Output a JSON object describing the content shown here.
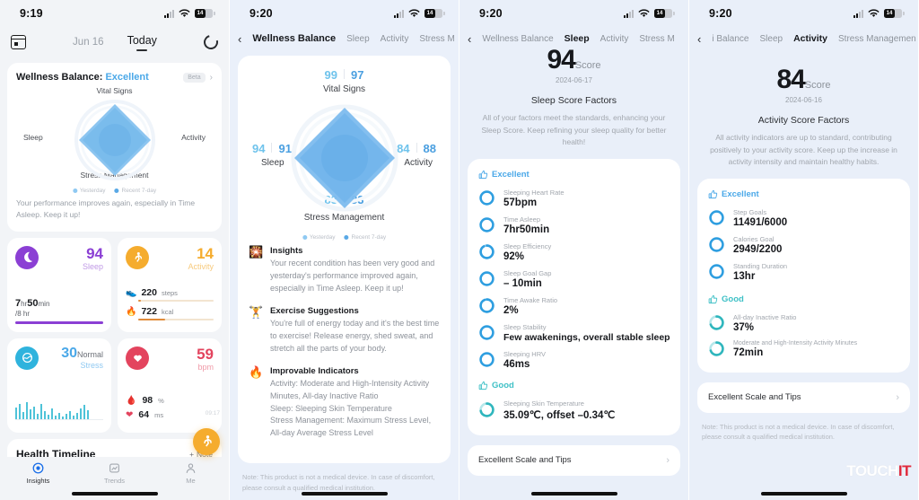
{
  "panel1": {
    "status": {
      "time": "9:19",
      "battery_label": "14"
    },
    "nav": {
      "calendar_icon": "calendar-icon",
      "prev_date": "Jun 16",
      "current": "Today",
      "refresh_icon": "refresh-icon"
    },
    "wellness": {
      "title_prefix": "Wellness Balance: ",
      "rating": "Excellent",
      "beta": "Beta",
      "chevron": "›",
      "axes": {
        "top": "Vital Signs",
        "left": "Sleep",
        "right": "Activity",
        "bottom": "Stress Management"
      },
      "legend": [
        "Yesterday",
        "Recent 7-day"
      ],
      "note": "Your performance improves again, especially in Time Asleep. Keep it up!"
    },
    "stats": {
      "sleep": {
        "icon": "moon-icon",
        "value": "94",
        "label": "Sleep",
        "duration_h": "7",
        "h_unit": "hr",
        "duration_m": "50",
        "m_unit": "min",
        "goal": "/8 hr",
        "progress_pct": 98,
        "color": "#8b3fd4"
      },
      "activity": {
        "icon": "runner-icon",
        "value": "14",
        "label": "Activity",
        "rows": [
          {
            "icon": "👟",
            "value": "220",
            "unit": "steps",
            "pct": 4
          },
          {
            "icon": "🔥",
            "value": "722",
            "unit": "kcal",
            "pct": 36
          }
        ],
        "color": "#f5ac2e"
      },
      "stress": {
        "icon": "stress-icon",
        "value": "30",
        "state": "Normal",
        "label": "Stress",
        "color": "#2fb3dd"
      },
      "heart": {
        "icon": "heart-icon",
        "value": "59",
        "label": "bpm",
        "rows": [
          {
            "icon": "🩸",
            "value": "98",
            "unit": "%"
          },
          {
            "icon": "❤",
            "value": "64",
            "unit": "ms"
          }
        ],
        "time": "09:17",
        "color": "#e3445e"
      }
    },
    "fab": {
      "icon": "runner-icon"
    },
    "timeline": {
      "title": "Health Timeline",
      "note_label": "Note",
      "plus": "+"
    },
    "tabs": [
      {
        "name": "tab-insights",
        "label": "Insights",
        "icon": "target-icon",
        "active": true
      },
      {
        "name": "tab-trends",
        "label": "Trends",
        "icon": "chart-icon",
        "active": false
      },
      {
        "name": "tab-me",
        "label": "Me",
        "icon": "person-icon",
        "active": false
      }
    ]
  },
  "panel2": {
    "status": {
      "time": "9:20"
    },
    "nav": {
      "back": "‹",
      "tabs": [
        "Wellness Balance",
        "Sleep",
        "Activity",
        "Stress M"
      ],
      "active_index": 0
    },
    "radar": {
      "vital": {
        "yesterday": "99",
        "recent": "97",
        "label": "Vital Signs"
      },
      "sleep": {
        "yesterday": "94",
        "recent": "91",
        "label": "Sleep"
      },
      "activity": {
        "yesterday": "84",
        "recent": "88",
        "label": "Activity"
      },
      "stress": {
        "yesterday": "83",
        "recent": "83",
        "label": "Stress Management"
      },
      "legend": [
        "Yesterday",
        "Recent 7-day"
      ]
    },
    "insights": [
      {
        "icon": "🎇",
        "icon_name": "sparkle-icon",
        "title": "Insights",
        "body": "Your recent condition has been very good and yesterday's performance improved again, especially in Time Asleep. Keep it up!"
      },
      {
        "icon": "🏋",
        "icon_name": "dumbbell-icon",
        "title": "Exercise Suggestions",
        "body": "You're full of energy today and it's the best time to exercise! Release energy, shed sweat, and stretch all the parts of your body."
      },
      {
        "icon": "🔥",
        "icon_name": "flame-icon",
        "title": "Improvable Indicators",
        "body": "Activity: Moderate and High-Intensity Activity Minutes, All-day Inactive Ratio\nSleep: Sleeping Skin Temperature\nStress Management: Maximum Stress Level, All-day Average Stress Level"
      }
    ],
    "disclaimer": "Note: This product is not a medical device. In case of discomfort, please consult a qualified medical institution."
  },
  "panel3": {
    "status": {
      "time": "9:20"
    },
    "nav": {
      "back": "‹",
      "tabs": [
        "Wellness Balance",
        "Sleep",
        "Activity",
        "Stress M"
      ],
      "active_index": 1
    },
    "score": {
      "value": "94",
      "label": "Score",
      "date": "2024-06-17"
    },
    "factors_title": "Sleep Score Factors",
    "factors_sub": "All of your factors meet the standards, enhancing your Sleep Score. Keep refining your sleep quality for better health!",
    "groups": [
      {
        "grade": "Excellent",
        "grade_icon": "thumbs-up-icon",
        "color": "#4aa8e8",
        "items": [
          {
            "caption": "Sleeping Heart Rate",
            "value": "57bpm",
            "ring_pct": 100
          },
          {
            "caption": "Time Asleep",
            "value": "7hr50min",
            "ring_pct": 100
          },
          {
            "caption": "Sleep Efficiency",
            "value": "92%",
            "ring_pct": 92
          },
          {
            "caption": "Sleep Goal Gap",
            "value": "– 10min",
            "ring_pct": 100
          },
          {
            "caption": "Time Awake Ratio",
            "value": "2%",
            "ring_pct": 95
          },
          {
            "caption": "Sleep Stability",
            "value": "Few awakenings, overall stable sleep",
            "ring_pct": 100
          },
          {
            "caption": "Sleeping HRV",
            "value": "46ms",
            "ring_pct": 100
          }
        ]
      },
      {
        "grade": "Good",
        "grade_icon": "thumbs-up-icon",
        "color": "#3ec0c6",
        "items": [
          {
            "caption": "Sleeping Skin Temperature",
            "value": "35.09℃, offset –0.34℃",
            "ring_pct": 72
          }
        ]
      }
    ],
    "tips": {
      "label": "Excellent Scale and Tips",
      "chevron": "›"
    }
  },
  "panel4": {
    "status": {
      "time": "9:20"
    },
    "nav": {
      "back": "‹",
      "tabs": [
        "i Balance",
        "Sleep",
        "Activity",
        "Stress Managemen"
      ],
      "active_index": 2
    },
    "score": {
      "value": "84",
      "label": "Score",
      "date": "2024-06-16"
    },
    "factors_title": "Activity Score Factors",
    "factors_sub": "All activity indicators are up to standard, contributing positively to your activity score. Keep up the increase in activity intensity and maintain healthy habits.",
    "groups": [
      {
        "grade": "Excellent",
        "grade_icon": "thumbs-up-icon",
        "color": "#4aa8e8",
        "items": [
          {
            "caption": "Step Goals",
            "value": "11491/6000",
            "ring_pct": 100
          },
          {
            "caption": "Calories Goal",
            "value": "2949/2200",
            "ring_pct": 100
          },
          {
            "caption": "Standing Duration",
            "value": "13hr",
            "ring_pct": 100
          }
        ]
      },
      {
        "grade": "Good",
        "grade_icon": "thumbs-up-icon",
        "color": "#3ec0c6",
        "items": [
          {
            "caption": "All-day Inactive Ratio",
            "value": "37%",
            "ring_pct": 70
          },
          {
            "caption": "Moderate and High-Intensity Activity Minutes",
            "value": "72min",
            "ring_pct": 70
          }
        ]
      }
    ],
    "tips": {
      "label": "Excellent Scale and Tips",
      "chevron": "›"
    },
    "disclaimer": "Note: This product is not a medical device. In case of discomfort, please consult a qualified medical institution.",
    "watermark": {
      "part1": "TOUCH",
      "part2": "IT"
    }
  }
}
